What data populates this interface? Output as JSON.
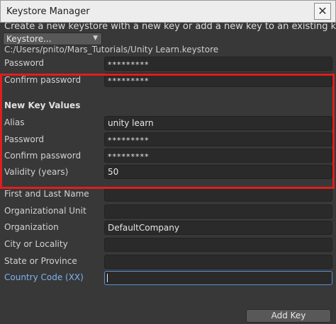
{
  "window": {
    "title": "Keystore Manager",
    "close_symbol": "✕"
  },
  "description": "Create a new keystore with a new key or add a new key to an existing keystore",
  "keystore_dropdown": {
    "value": "Keystore..."
  },
  "keystore_path": "C:/Users/pnito/Mars_Tutorials/Unity Learn.keystore",
  "keystore_section": {
    "password_label": "Password",
    "password_value": "*********",
    "confirm_label": "Confirm password",
    "confirm_value": "*********"
  },
  "new_key": {
    "heading": "New Key Values",
    "alias_label": "Alias",
    "alias_value": "unity learn",
    "password_label": "Password",
    "password_value": "*********",
    "confirm_label": "Confirm password",
    "confirm_value": "*********",
    "validity_label": "Validity (years)",
    "validity_value": "50",
    "name_label": "First and Last Name",
    "name_value": "",
    "org_unit_label": "Organizational Unit",
    "org_unit_value": "",
    "org_label": "Organization",
    "org_value": "DefaultCompany",
    "city_label": "City or Locality",
    "city_value": "",
    "state_label": "State or Province",
    "state_value": "",
    "country_label": "Country Code (XX)",
    "country_value": ""
  },
  "buttons": {
    "add_key": "Add Key"
  },
  "colors": {
    "highlight_box": "#e01e1e",
    "focus_label": "#7fb2ee"
  }
}
